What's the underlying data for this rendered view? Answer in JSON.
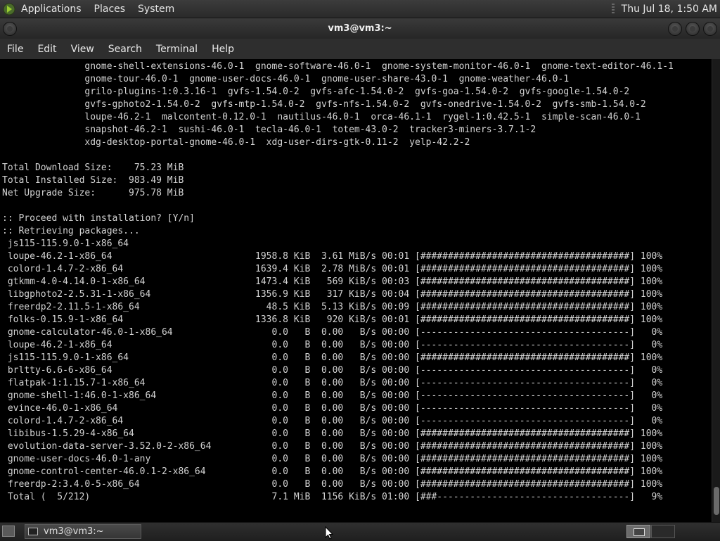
{
  "top_panel": {
    "menus": [
      "Applications",
      "Places",
      "System"
    ],
    "clock": "Thu Jul 18,  1:50 AM"
  },
  "window": {
    "title": "vm3@vm3:~"
  },
  "menubar": {
    "items": [
      "File",
      "Edit",
      "View",
      "Search",
      "Terminal",
      "Help"
    ]
  },
  "terminal": {
    "lines": [
      "               gnome-shell-extensions-46.0-1  gnome-software-46.0-1  gnome-system-monitor-46.0-1  gnome-text-editor-46.1-1",
      "               gnome-tour-46.0-1  gnome-user-docs-46.0-1  gnome-user-share-43.0-1  gnome-weather-46.0-1",
      "               grilo-plugins-1:0.3.16-1  gvfs-1.54.0-2  gvfs-afc-1.54.0-2  gvfs-goa-1.54.0-2  gvfs-google-1.54.0-2",
      "               gvfs-gphoto2-1.54.0-2  gvfs-mtp-1.54.0-2  gvfs-nfs-1.54.0-2  gvfs-onedrive-1.54.0-2  gvfs-smb-1.54.0-2",
      "               loupe-46.2-1  malcontent-0.12.0-1  nautilus-46.0-1  orca-46.1-1  rygel-1:0.42.5-1  simple-scan-46.0-1",
      "               snapshot-46.2-1  sushi-46.0-1  tecla-46.0-1  totem-43.0-2  tracker3-miners-3.7.1-2",
      "               xdg-desktop-portal-gnome-46.0-1  xdg-user-dirs-gtk-0.11-2  yelp-42.2-2",
      "",
      "Total Download Size:    75.23 MiB",
      "Total Installed Size:  983.49 MiB",
      "Net Upgrade Size:      975.78 MiB",
      "",
      ":: Proceed with installation? [Y/n]",
      ":: Retrieving packages...",
      " js115-115.9.0-1-x86_64",
      " loupe-46.2-1-x86_64                          1958.8 KiB  3.61 MiB/s 00:01 [######################################] 100%",
      " colord-1.4.7-2-x86_64                        1639.4 KiB  2.78 MiB/s 00:01 [######################################] 100%",
      " gtkmm-4.0-4.14.0-1-x86_64                    1473.4 KiB   569 KiB/s 00:03 [######################################] 100%",
      " libgphoto2-2.5.31-1-x86_64                   1356.9 KiB   317 KiB/s 00:04 [######################################] 100%",
      " freerdp2-2.11.5-1-x86_64                       48.5 KiB  5.13 KiB/s 00:09 [######################################] 100%",
      " folks-0.15.9-1-x86_64                        1336.8 KiB   920 KiB/s 00:01 [######################################] 100%",
      " gnome-calculator-46.0-1-x86_64                  0.0   B  0.00   B/s 00:00 [--------------------------------------]   0%",
      " loupe-46.2-1-x86_64                             0.0   B  0.00   B/s 00:00 [--------------------------------------]   0%",
      " js115-115.9.0-1-x86_64                          0.0   B  0.00   B/s 00:00 [######################################] 100%",
      " brltty-6.6-6-x86_64                             0.0   B  0.00   B/s 00:00 [--------------------------------------]   0%",
      " flatpak-1:1.15.7-1-x86_64                       0.0   B  0.00   B/s 00:00 [--------------------------------------]   0%",
      " gnome-shell-1:46.0-1-x86_64                     0.0   B  0.00   B/s 00:00 [--------------------------------------]   0%",
      " evince-46.0-1-x86_64                            0.0   B  0.00   B/s 00:00 [--------------------------------------]   0%",
      " colord-1.4.7-2-x86_64                           0.0   B  0.00   B/s 00:00 [--------------------------------------]   0%",
      " libibus-1.5.29-4-x86_64                         0.0   B  0.00   B/s 00:00 [######################################] 100%",
      " evolution-data-server-3.52.0-2-x86_64           0.0   B  0.00   B/s 00:00 [######################################] 100%",
      " gnome-user-docs-46.0-1-any                      0.0   B  0.00   B/s 00:00 [######################################] 100%",
      " gnome-control-center-46.0.1-2-x86_64            0.0   B  0.00   B/s 00:00 [######################################] 100%",
      " freerdp-2:3.4.0-5-x86_64                        0.0   B  0.00   B/s 00:00 [######################################] 100%",
      " Total (  5/212)                                 7.1 MiB  1156 KiB/s 01:00 [###-----------------------------------]   9%"
    ]
  },
  "taskbar": {
    "task_label": "vm3@vm3:~"
  }
}
